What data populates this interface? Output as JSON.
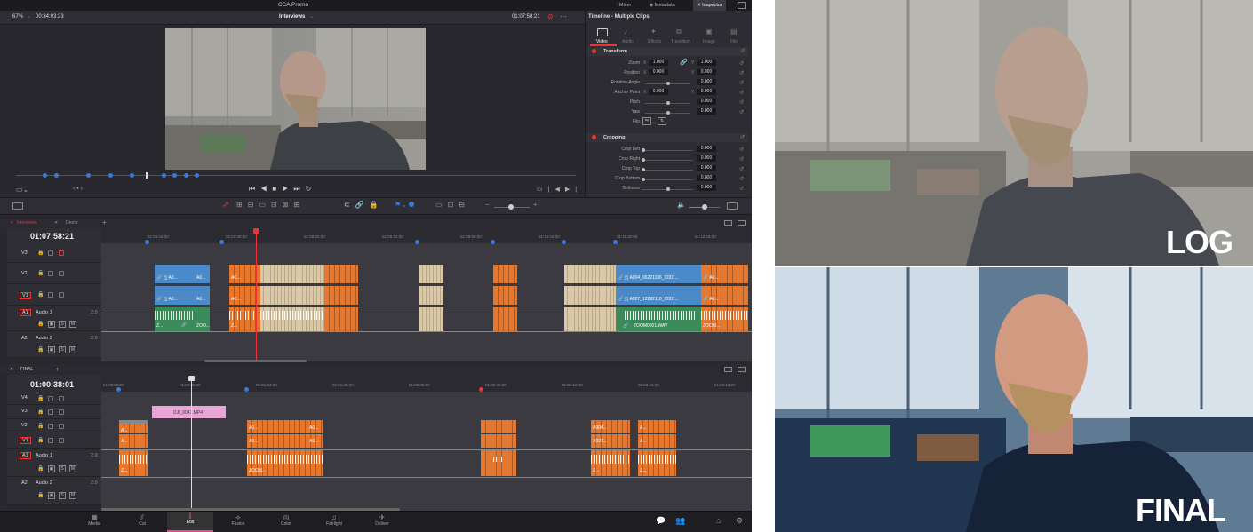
{
  "window": {
    "title": "CCA Promo"
  },
  "topbar": {
    "mixer": "Mixer",
    "metadata": "Metadata",
    "inspector": "Inspector"
  },
  "viewer": {
    "zoom": "67%",
    "timecode_left": "00:34:03:23",
    "clip_name": "Interviews",
    "timecode_right": "01:07:58:21"
  },
  "inspector": {
    "title": "Timeline - Multiple Clips",
    "tabs": [
      "Video",
      "Audio",
      "Effects",
      "Transition",
      "Image",
      "File"
    ],
    "transform_label": "Transform",
    "zoom": {
      "label": "Zoom",
      "x": "1.000",
      "y": "1.000"
    },
    "position": {
      "label": "Position",
      "x": "0.000",
      "y": "0.000"
    },
    "rotation": {
      "label": "Rotation Angle",
      "value": "0.000"
    },
    "anchor": {
      "label": "Anchor Point",
      "x": "0.000",
      "y": "0.000"
    },
    "pitch": {
      "label": "Pitch",
      "value": "0.000"
    },
    "yaw": {
      "label": "Yaw",
      "value": "0.000"
    },
    "flip": {
      "label": "Flip"
    },
    "cropping_label": "Cropping",
    "crop_left": {
      "label": "Crop Left",
      "value": "0.000"
    },
    "crop_right": {
      "label": "Crop Right",
      "value": "0.000"
    },
    "crop_top": {
      "label": "Crop Top",
      "value": "0.000"
    },
    "crop_bottom": {
      "label": "Crop Bottom",
      "value": "0.000"
    },
    "softness": {
      "label": "Softness",
      "value": "0.000"
    },
    "x": "X",
    "y": "Y"
  },
  "timeline1": {
    "tabs": [
      "Interviews",
      "Drone"
    ],
    "timecode": "01:07:58:21",
    "ruler": [
      "01:06:44:00",
      "01:07:40:00",
      "01:08:26:00",
      "01:09:12:00",
      "01:09:58:00",
      "01:10:44:00",
      "01:11:30:00",
      "01:12:16:00"
    ],
    "tracks": [
      {
        "id": "V3",
        "name": ""
      },
      {
        "id": "V2",
        "name": ""
      },
      {
        "id": "V1",
        "name": ""
      },
      {
        "id": "A1",
        "name": "Audio 1",
        "level": "2.0"
      },
      {
        "id": "A2",
        "name": "Audio 2",
        "level": "2.0"
      }
    ],
    "clips": {
      "v2a": "A0...",
      "v2b": "A0...",
      "v2c": "A0...",
      "v2d": "A004_06221106_C001...",
      "v2e": "A0...",
      "v1a": "A0...",
      "v1b": "A0...",
      "v1c": "A0...",
      "v1d": "A027_12292118_C001...",
      "v1e": "A0...",
      "a1a": "Z...",
      "a1b": "ZOO...",
      "a1c": "Z...",
      "a1d": "ZOOM0001.WAV",
      "a1e": "ZOOM..."
    }
  },
  "timeline2": {
    "tabs": [
      "FINAL"
    ],
    "timecode": "01:00:38:01",
    "ruler": [
      "01:00:00:00",
      "01:00:32:00",
      "01:01:04:00",
      "01:01:36:00",
      "01:02:08:00",
      "01:02:40:00",
      "01:03:12:00",
      "01:03:44:00",
      "01:04:16:00"
    ],
    "tracks": [
      {
        "id": "V4",
        "name": ""
      },
      {
        "id": "V3",
        "name": ""
      },
      {
        "id": "V2",
        "name": ""
      },
      {
        "id": "V1",
        "name": ""
      },
      {
        "id": "A1",
        "name": "Audio 1",
        "level": "2.0"
      },
      {
        "id": "A2",
        "name": "Audio 2",
        "level": "2.0"
      }
    ],
    "clips": {
      "pink": "DJI_0041.MP4",
      "v2a": "A...",
      "v2b": "A0...",
      "v2c": "A0...",
      "v2d": "A004...",
      "v2e": "A...",
      "v1a": "A...",
      "v1b": "A0...",
      "v1c": "A0...",
      "v1d": "A027...",
      "v1e": "A...",
      "a1a": "Z...",
      "a1b": "ZOOM...",
      "a1c": "Z...",
      "a1d": "Z..."
    }
  },
  "pages": [
    {
      "label": "Media",
      "icon": "media-icon"
    },
    {
      "label": "Cut",
      "icon": "cut-icon"
    },
    {
      "label": "Edit",
      "icon": "edit-icon"
    },
    {
      "label": "Fusion",
      "icon": "fusion-icon"
    },
    {
      "label": "Color",
      "icon": "color-icon"
    },
    {
      "label": "Fairlight",
      "icon": "fairlight-icon"
    },
    {
      "label": "Deliver",
      "icon": "deliver-icon"
    }
  ],
  "comparison": {
    "top_label": "LOG",
    "bottom_label": "FINAL"
  },
  "colors": {
    "accent": "#e84b8a",
    "playhead": "#e33333",
    "clip_blue": "#4a8ac8",
    "clip_orange": "#e8772e",
    "clip_beige": "#d9c9a8",
    "clip_green": "#3a8a5a",
    "clip_pink": "#e9a5d6"
  }
}
